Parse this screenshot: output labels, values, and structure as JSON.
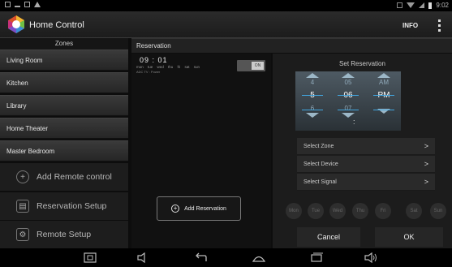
{
  "status_bar": {
    "time": "9:02"
  },
  "app": {
    "title": "Home Control",
    "info_label": "INFO"
  },
  "zones": {
    "header": "Zones",
    "items": [
      "Living Room",
      "Kitchen",
      "Library",
      "Home Theater",
      "Master Bedroom"
    ]
  },
  "sidebar_actions": [
    {
      "label": "Add Remote control",
      "icon": "plus-circle-icon"
    },
    {
      "label": "Reservation Setup",
      "icon": "calendar-icon"
    },
    {
      "label": "Remote Setup",
      "icon": "gear-icon"
    }
  ],
  "reservation": {
    "header": "Reservation",
    "entry": {
      "time": "09 : 01",
      "days": "mon tue wed thu fri sat sun",
      "device": "ADC TV : Power",
      "toggle_label": "ON"
    },
    "add_button_label": "Add Reservation"
  },
  "set_reservation": {
    "title": "Set Reservation",
    "picker": {
      "hour": {
        "prev": "4",
        "current": "5",
        "next": "6"
      },
      "minute": {
        "prev": "05",
        "current": "06",
        "next": "07"
      },
      "ampm": {
        "prev": "AM",
        "current": "PM",
        "next": ""
      }
    },
    "select_rows": [
      "Select Zone",
      "Select Device",
      "Select Signal"
    ],
    "chevron": ">",
    "days": [
      "Mon",
      "Tue",
      "Wed",
      "Thu",
      "Fri",
      "Sat",
      "Sun"
    ],
    "cancel_label": "Cancel",
    "ok_label": "OK"
  },
  "colors": {
    "accent_blue": "#41a7e0",
    "picker_bg": "#4e5a63"
  }
}
